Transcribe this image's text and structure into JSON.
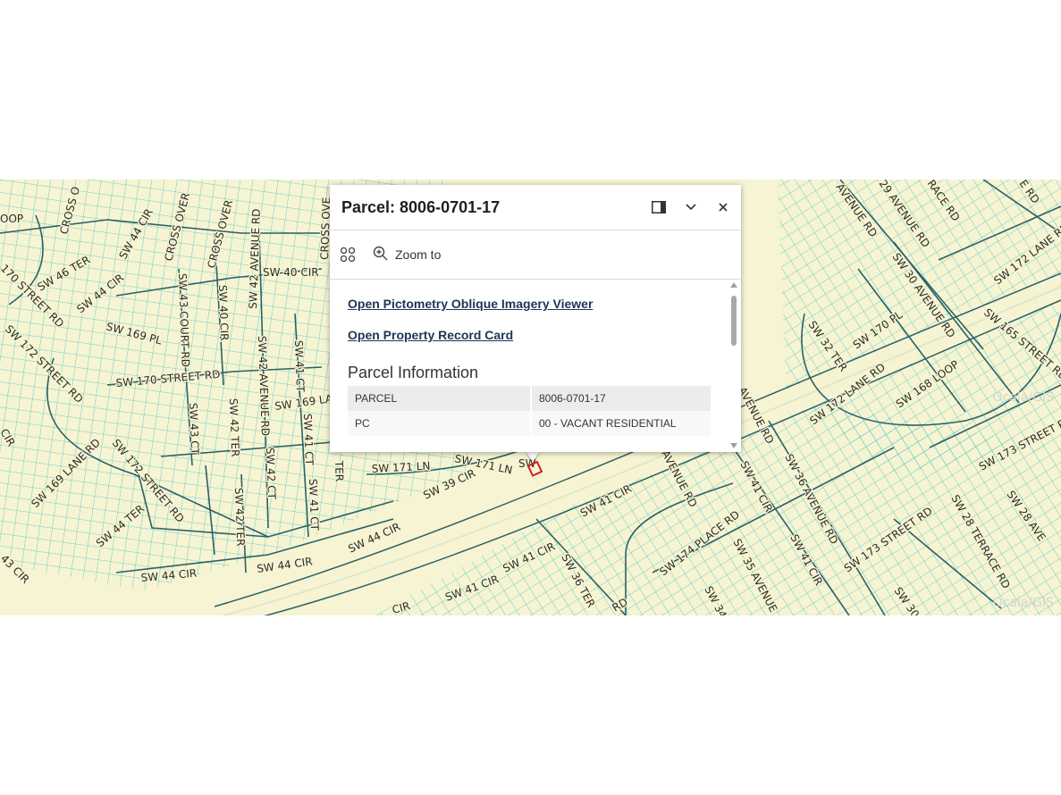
{
  "popup": {
    "title": "Parcel: 8006-0701-17",
    "dock_icon": "dock-side-icon",
    "collapse_icon": "chevron-down-icon",
    "close_icon": "close-icon",
    "actions": [
      {
        "icon": "grid-icon",
        "label": ""
      },
      {
        "icon": "zoom-in-icon",
        "label": "Zoom to"
      }
    ],
    "links": [
      "Open Pictometry Oblique Imagery Viewer",
      "Open Property Record Card"
    ],
    "section_title": "Parcel Information",
    "table": [
      {
        "field": "PARCEL",
        "value": "8006-0701-17"
      },
      {
        "field": "PC",
        "value": "00 - VACANT RESIDENTIAL"
      }
    ]
  },
  "map": {
    "colors": {
      "land": "#f6f4d2",
      "parcel_line": "#45c4c4",
      "road_casing": "#2b6068",
      "selected_parcel": "#d02020"
    },
    "watermarks": [
      "Ocala/GIS",
      "Ocala/GIS"
    ],
    "road_labels": [
      "OOP",
      "CROSS O",
      "SW 44 CIR",
      "CROSS OVER",
      "CROSS OVER",
      "SW 42 AVENUE RD",
      "CROSS OVE",
      "SW 46 TER",
      "SW 44 CIR",
      "SW 43 COURT RD",
      "SW 40 CIR",
      "SW 40 CIR",
      "SW 42 AVENUE RD",
      "SW 41 CT",
      "170 STREET RD",
      "SW 172 STREET RD",
      "SW 169 PL",
      "SW 170 STREET RD",
      "SW 169 LA",
      "SW 43 CT",
      "SW 42 TER",
      "SW 42 CT",
      "SW 41 CT",
      "SW 41 CT",
      "TER",
      "CIR",
      "SW 169 LANE RD",
      "SW 172 STREET RD",
      "SW 44 TER",
      "SW 42 TER",
      "SW 171 LN",
      "SW 171 LN",
      "SW",
      "SW 39 CIR",
      "SW 44 CIR",
      "SW 44 CIR",
      "SW 44 CIR",
      "43 CIR",
      "CIR",
      "SW 41 CIR",
      "SW 41 CIR",
      "SW 41 CIR",
      "SW 36 TER",
      "RD",
      "SW 34",
      "AVENUE RD",
      "SW 174 PLACE RD",
      "SW 35 AVENUE",
      "SW 41 CIR",
      "SW 41 CIR",
      "SW 36 AVENUE RD",
      "AVENUE RD",
      "SW 173 STREET RD",
      "SW 28 TERRACE RD",
      "SW 28 AVE",
      "SW 30",
      "SW 173 STREET RD",
      "AVENUE RD",
      "29 AVENUE RD",
      "RACE RD",
      "E RD",
      "SW 30 AVENUE RD",
      "SW 172 LANE RD",
      "SW 32 TER",
      "SW 170 PL",
      "SW 165 STREET RD",
      "SW 172 LANE RD",
      "SW 168 LOOP"
    ]
  }
}
